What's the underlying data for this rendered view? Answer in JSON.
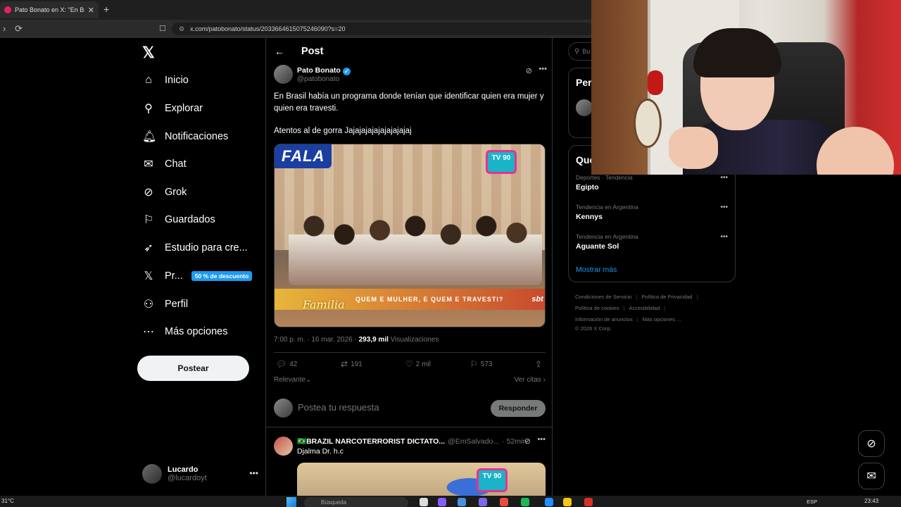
{
  "browser": {
    "tab_title": "Pato Bonato en X: \"En Brasil",
    "url": "x.com/patobonato/status/2033664615075246090?s=20"
  },
  "nav": {
    "items": [
      {
        "icon": "home-icon",
        "label": "Inicio"
      },
      {
        "icon": "search-icon",
        "label": "Explorar"
      },
      {
        "icon": "bell-icon",
        "label": "Notificaciones"
      },
      {
        "icon": "mail-icon",
        "label": "Chat"
      },
      {
        "icon": "grok-icon",
        "label": "Grok"
      },
      {
        "icon": "bookmark-icon",
        "label": "Guardados"
      },
      {
        "icon": "rocket-icon",
        "label": "Estudio para cre..."
      },
      {
        "icon": "x-premium-icon",
        "label": "Pr..."
      },
      {
        "icon": "person-icon",
        "label": "Perfil"
      },
      {
        "icon": "more-circle-icon",
        "label": "Más opciones"
      }
    ],
    "premium_badge": "50 % de descuento",
    "post_button": "Postear",
    "account_name": "Lucardo",
    "account_handle": "@lucardoyt"
  },
  "post": {
    "page_title": "Post",
    "author_name": "Pato Bonato",
    "author_handle": "@patobonato",
    "text_line1": "En Brasil había un programa donde tenían que identificar quien era mujer y quien era travesti.",
    "text_line2": "Atentos al de gorra Jajajajajajajajajajaj",
    "media": {
      "logo": "FALA",
      "tv_badge": "TV 90",
      "caption": "QUEM E MULHER, E QUEM E TRAVESTI?",
      "channel": "sbt",
      "show": "Familia"
    },
    "timestamp": "7:00 p. m. · 16 mar. 2026 · ",
    "views_count": "293,9 mil",
    "views_label": " Visualizaciones",
    "replies": "42",
    "reposts": "191",
    "likes": "2 mil",
    "bookmarks": "573",
    "sort_label": "Relevante",
    "quotes_label": "Ver citas"
  },
  "reply": {
    "placeholder": "Postea tu respuesta",
    "button": "Responder"
  },
  "comment": {
    "name": "🇧🇷BRAZIL NARCOTERRORIST DICTATO...",
    "handle": "@EmSalvado...",
    "time": "· 52min",
    "text": "Djalma Dr. h.c",
    "tv_badge": "TV 90"
  },
  "sidebar": {
    "search_placeholder": "Bu",
    "who_heading": "Per",
    "trends_heading": "Qué",
    "trends": [
      {
        "meta": "Deportes · Tendencia",
        "name": "Egipto"
      },
      {
        "meta": "Tendencia en Argentina",
        "name": "Kennys"
      },
      {
        "meta": "Tendencia en Argentina",
        "name": "Aguante Sol"
      }
    ],
    "show_more": "Mostrar más",
    "footer": {
      "terms": "Condiciones de Servicio",
      "privacy": "Política de Privacidad",
      "cookies": "Política de cookies",
      "accessibility": "Accesibilidad",
      "ads": "Información de anuncios",
      "more": "Más opciones ...",
      "copyright": "© 2026 X Corp."
    }
  },
  "taskbar": {
    "weather": "31°C",
    "search": "Búsqueda",
    "lang": "ESP",
    "time": "23:43"
  },
  "colors": {
    "accent": "#1d9bf0",
    "background": "#000000",
    "muted": "#71767b"
  }
}
